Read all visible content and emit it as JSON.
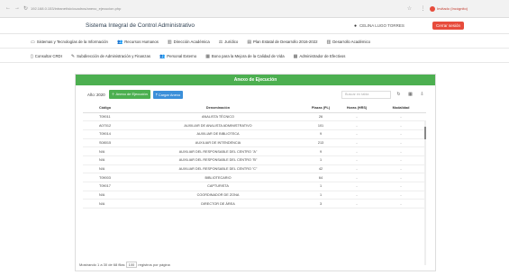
{
  "browser": {
    "url": "192.168.0.153/intranet/sic/cuadros/anexo_ejecucion.php",
    "profile": "Invitado (Incógnito)"
  },
  "header": {
    "title": "Sistema Integral de Control Administrativo",
    "user": "CELINA LUGO TORRES",
    "logout": "Cerrar sesión"
  },
  "menu1": [
    {
      "label": "Sistemas y Tecnologías de la Información",
      "icon": "monitor-icon"
    },
    {
      "label": "Recursos Humanos",
      "icon": "users-icon"
    },
    {
      "label": "Dirección Académica",
      "icon": "building-icon"
    },
    {
      "label": "Jurídico",
      "icon": "gavel-icon"
    },
    {
      "label": "Plan Estatal de Desarrollo 2016-2022",
      "icon": "chart-icon"
    },
    {
      "label": "Desarrollo Académico",
      "icon": "building-icon"
    }
  ],
  "menu2": [
    {
      "label": "Consultar CRDI",
      "icon": "document-icon"
    },
    {
      "label": "Subdirección de Administración y Finanzas",
      "icon": "wrench-icon"
    },
    {
      "label": "Personal Externo",
      "icon": "users-icon"
    },
    {
      "label": "Bono para la Mejora de la Calidad de Vida",
      "icon": "grid-icon"
    },
    {
      "label": "Administrador de Efectivos",
      "icon": "grid-icon"
    }
  ],
  "panel": {
    "title": "Anexo de Ejecución",
    "year_label": "Año: 2020",
    "btn_anexo": "Anexo de Ejecución",
    "btn_cargar": "Cargar Anexo",
    "search_placeholder": "Buscar en tabla"
  },
  "table": {
    "headers": [
      "Código",
      "Denominación",
      "Plazas (PL)",
      "Horas (HRS)",
      "Modalidad"
    ],
    "rows": [
      [
        "T09011",
        "ANALISTA TÉCNICO",
        "26",
        "-",
        "-"
      ],
      [
        "A07012",
        "AUXILIAR DE ANALISTA ADMINISTRATIVO",
        "101",
        "-",
        "-"
      ],
      [
        "T09014",
        "AUXILIAR DE BIBLIOTECA",
        "9",
        "-",
        "-"
      ],
      [
        "S08015",
        "AUXILIAR DE INTENDENCIA",
        "213",
        "-",
        "-"
      ],
      [
        "N/A",
        "AUXILIAR DEL RESPONSABLE DEL CENTRO \"A\"",
        "9",
        "-",
        "-"
      ],
      [
        "N/A",
        "AUXILIAR DEL RESPONSABLE DEL CENTRO \"B\"",
        "1",
        "-",
        "-"
      ],
      [
        "N/A",
        "AUXILIAR DEL RESPONSABLE DEL CENTRO \"C\"",
        "42",
        "-",
        "-"
      ],
      [
        "T09003",
        "BIBLIOTECARIO",
        "64",
        "-",
        "-"
      ],
      [
        "T09017",
        "CAPTURISTA",
        "1",
        "-",
        "-"
      ],
      [
        "N/A",
        "COORDINADOR DE ZONA",
        "1",
        "-",
        "-"
      ],
      [
        "N/A",
        "DIRECTOR DE ÁREA",
        "3",
        "-",
        "-"
      ]
    ]
  },
  "footer": {
    "text_before": "Mostrando 1 a 30 de 68 filas",
    "page_size": "100",
    "text_after": "registros por página"
  }
}
